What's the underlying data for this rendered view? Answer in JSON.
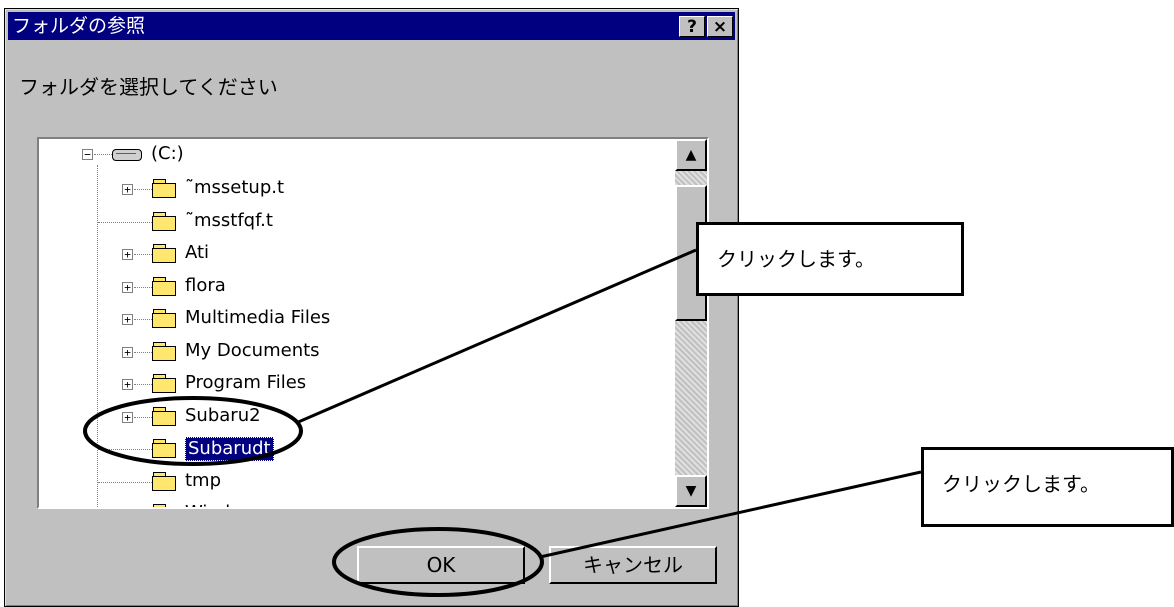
{
  "window": {
    "title": "フォルダの参照",
    "help_glyph": "?",
    "close_glyph": "×"
  },
  "prompt": "フォルダを選択してください",
  "tree": {
    "root": {
      "label": "(C:)",
      "icon": "drive-icon"
    },
    "items": [
      {
        "label": "˜mssetup.t",
        "expander": "+",
        "icon": "folder-icon"
      },
      {
        "label": "˜msstfqf.t",
        "expander": "",
        "icon": "folder-icon"
      },
      {
        "label": "Ati",
        "expander": "+",
        "icon": "folder-icon"
      },
      {
        "label": "flora",
        "expander": "+",
        "icon": "folder-icon"
      },
      {
        "label": "Multimedia Files",
        "expander": "+",
        "icon": "folder-icon"
      },
      {
        "label": "My Documents",
        "expander": "+",
        "icon": "folder-icon"
      },
      {
        "label": "Program Files",
        "expander": "+",
        "icon": "folder-icon"
      },
      {
        "label": "Subaru2",
        "expander": "+",
        "icon": "folder-icon"
      },
      {
        "label": "Subarudt",
        "expander": "",
        "icon": "open-folder-icon",
        "selected": true
      },
      {
        "label": "tmp",
        "expander": "",
        "icon": "folder-icon"
      },
      {
        "label": "Windows",
        "expander": "+",
        "icon": "folder-icon"
      }
    ]
  },
  "buttons": {
    "ok": "OK",
    "cancel": "キャンセル"
  },
  "callouts": {
    "first": "クリックします。",
    "second": "クリックします。"
  }
}
